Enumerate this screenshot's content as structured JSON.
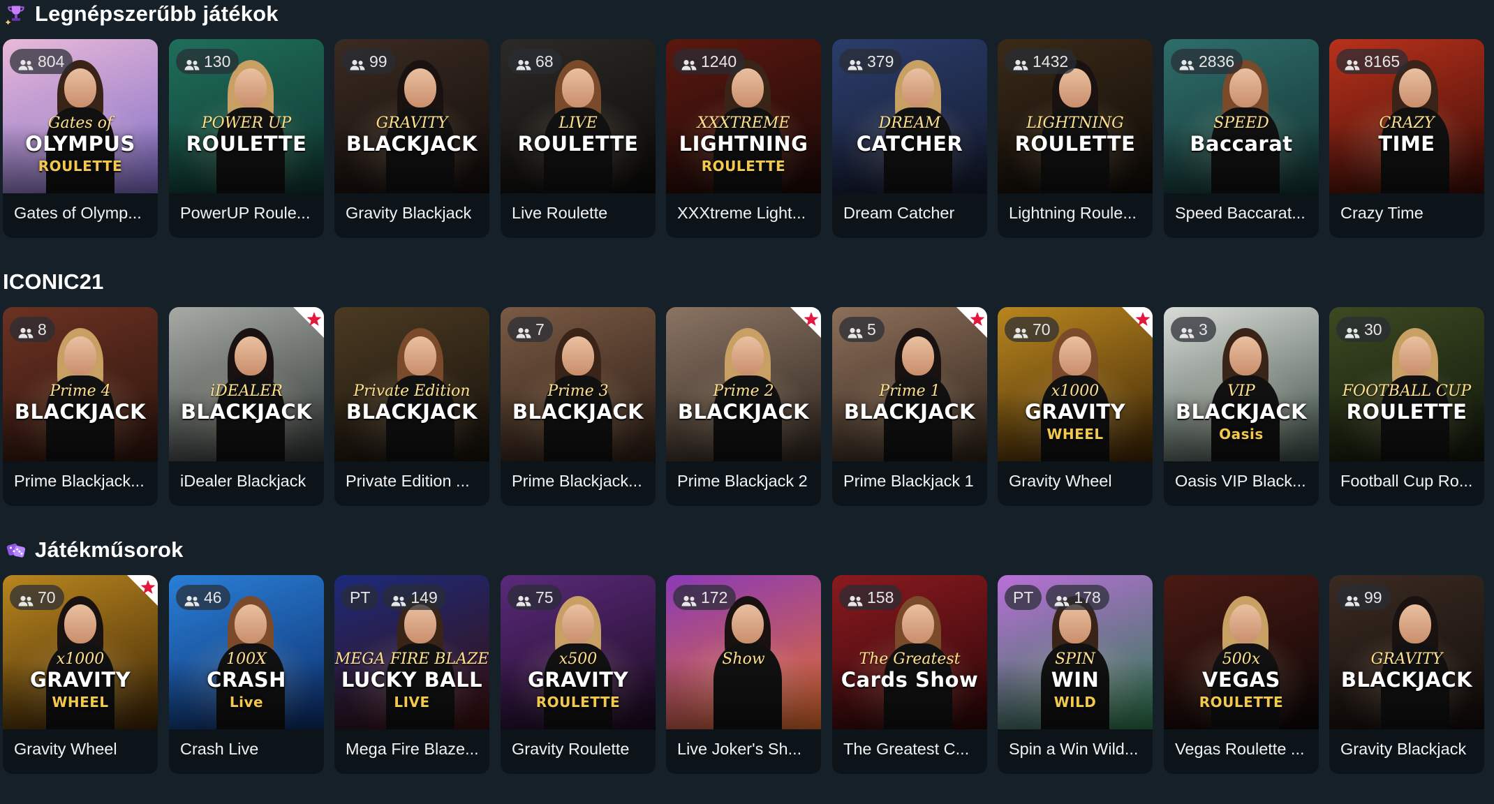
{
  "sections": [
    {
      "title": "Legnépszerűbb játékok",
      "icon": "trophy-sparkle-icon",
      "cards": [
        {
          "title": "Gates of Olymp...",
          "players": "804",
          "pt": "",
          "fav": false,
          "logo": "Gates of",
          "logo2": "OLYMPUS",
          "logo3": "ROULETTE",
          "bg": "#e9b9d8",
          "bg2": "#7d6cc7"
        },
        {
          "title": "PowerUP Roule...",
          "players": "130",
          "pt": "",
          "fav": false,
          "logo": "POWER UP",
          "logo2": "ROULETTE",
          "logo3": "",
          "bg": "#1f6e5a",
          "bg2": "#0f3530"
        },
        {
          "title": "Gravity Blackjack",
          "players": "99",
          "pt": "",
          "fav": false,
          "logo": "GRAVITY",
          "logo2": "BLACKJACK",
          "logo3": "",
          "bg": "#3a2b22",
          "bg2": "#120c0a"
        },
        {
          "title": "Live Roulette",
          "players": "68",
          "pt": "",
          "fav": false,
          "logo": "LIVE",
          "logo2": "ROULETTE",
          "logo3": "",
          "bg": "#2c2a26",
          "bg2": "#0b0a09"
        },
        {
          "title": "XXXtreme Light...",
          "players": "1240",
          "pt": "",
          "fav": false,
          "logo": "XXXTREME",
          "logo2": "LIGHTNING",
          "logo3": "ROULETTE",
          "bg": "#5a1810",
          "bg2": "#1a0806"
        },
        {
          "title": "Dream Catcher",
          "players": "379",
          "pt": "",
          "fav": false,
          "logo": "DREAM",
          "logo2": "CATCHER",
          "logo3": "",
          "bg": "#2b3d6b",
          "bg2": "#141a2e"
        },
        {
          "title": "Lightning Roule...",
          "players": "1432",
          "pt": "",
          "fav": false,
          "logo": "LIGHTNING",
          "logo2": "ROULETTE",
          "logo3": "",
          "bg": "#3a2a18",
          "bg2": "#0e0a06"
        },
        {
          "title": "Speed Baccarat...",
          "players": "2836",
          "pt": "",
          "fav": false,
          "logo": "SPEED",
          "logo2": "Baccarat",
          "logo3": "",
          "bg": "#2f6d6a",
          "bg2": "#123332"
        },
        {
          "title": "Crazy Time",
          "players": "8165",
          "pt": "",
          "fav": false,
          "logo": "CRAZY",
          "logo2": "TIME",
          "logo3": "",
          "bg": "#b8311c",
          "bg2": "#3b0c06"
        }
      ]
    },
    {
      "title": "ICONIC21",
      "icon": "",
      "cards": [
        {
          "title": "Prime Blackjack...",
          "players": "8",
          "pt": "",
          "fav": false,
          "logo": "Prime 4",
          "logo2": "BLACKJACK",
          "logo3": "",
          "bg": "#6b3222",
          "bg2": "#2a130c"
        },
        {
          "title": "iDealer Blackjack",
          "players": "",
          "pt": "",
          "fav": true,
          "logo": "iDEALER",
          "logo2": "BLACKJACK",
          "logo3": "",
          "bg": "#a7aaa5",
          "bg2": "#2e3533"
        },
        {
          "title": "Private Edition ...",
          "players": "",
          "pt": "",
          "fav": false,
          "logo": "Private Edition",
          "logo2": "BLACKJACK",
          "logo3": "",
          "bg": "#4b3a22",
          "bg2": "#15100a"
        },
        {
          "title": "Prime Blackjack...",
          "players": "7",
          "pt": "",
          "fav": false,
          "logo": "Prime 3",
          "logo2": "BLACKJACK",
          "logo3": "",
          "bg": "#7a5a44",
          "bg2": "#2a1c14"
        },
        {
          "title": "Prime Blackjack 2",
          "players": "",
          "pt": "",
          "fav": true,
          "logo": "Prime 2",
          "logo2": "BLACKJACK",
          "logo3": "",
          "bg": "#8a7463",
          "bg2": "#2d241e"
        },
        {
          "title": "Prime Blackjack 1",
          "players": "5",
          "pt": "",
          "fav": true,
          "logo": "Prime 1",
          "logo2": "BLACKJACK",
          "logo3": "",
          "bg": "#8d6f5a",
          "bg2": "#2d2219"
        },
        {
          "title": "Gravity Wheel",
          "players": "70",
          "pt": "",
          "fav": true,
          "logo": "x1000",
          "logo2": "GRAVITY",
          "logo3": "WHEEL",
          "bg": "#b8861f",
          "bg2": "#3d2506"
        },
        {
          "title": "Oasis VIP Black...",
          "players": "3",
          "pt": "",
          "fav": false,
          "logo": "VIP",
          "logo2": "BLACKJACK",
          "logo3": "Oasis",
          "bg": "#d9dcd6",
          "bg2": "#3a4b44"
        },
        {
          "title": "Football Cup Ro...",
          "players": "30",
          "pt": "",
          "fav": false,
          "logo": "FOOTBALL CUP",
          "logo2": "ROULETTE",
          "logo3": "",
          "bg": "#3c4a22",
          "bg2": "#10150a"
        }
      ]
    },
    {
      "title": "Játékműsorok",
      "icon": "dice-icon",
      "cards": [
        {
          "title": "Gravity Wheel",
          "players": "70",
          "pt": "",
          "fav": true,
          "logo": "x1000",
          "logo2": "GRAVITY",
          "logo3": "WHEEL",
          "bg": "#b8861f",
          "bg2": "#3d2506"
        },
        {
          "title": "Crash Live",
          "players": "46",
          "pt": "",
          "fav": false,
          "logo": "100X",
          "logo2": "CRASH",
          "logo3": "Live",
          "bg": "#2a7fd6",
          "bg2": "#0c2d6b"
        },
        {
          "title": "Mega Fire Blaze...",
          "players": "149",
          "pt": "PT",
          "fav": false,
          "logo": "MEGA FIRE BLAZE",
          "logo2": "LUCKY BALL",
          "logo3": "LIVE",
          "bg": "#1c2a7a",
          "bg2": "#3a0f0a"
        },
        {
          "title": "Gravity Roulette",
          "players": "75",
          "pt": "",
          "fav": false,
          "logo": "x500",
          "logo2": "GRAVITY",
          "logo3": "ROULETTE",
          "bg": "#5a2a7a",
          "bg2": "#1a0a1f"
        },
        {
          "title": "Live Joker's Sh...",
          "players": "172",
          "pt": "",
          "fav": false,
          "logo": "Show",
          "logo2": "",
          "logo3": "",
          "bg": "#8a3ab8",
          "bg2": "#e46e2a"
        },
        {
          "title": "The Greatest C...",
          "players": "158",
          "pt": "",
          "fav": false,
          "logo": "The Greatest",
          "logo2": "Cards Show",
          "logo3": "",
          "bg": "#8a1a1f",
          "bg2": "#2a0608"
        },
        {
          "title": "Spin a Win Wild...",
          "players": "178",
          "pt": "PT",
          "fav": false,
          "logo": "SPIN",
          "logo2": "WIN",
          "logo3": "WILD",
          "bg": "#b96fd8",
          "bg2": "#2a7a4a"
        },
        {
          "title": "Vegas Roulette ...",
          "players": "",
          "pt": "",
          "fav": false,
          "logo": "500x",
          "logo2": "VEGAS",
          "logo3": "ROULETTE",
          "bg": "#4a1a14",
          "bg2": "#0c0606"
        },
        {
          "title": "Gravity Blackjack",
          "players": "99",
          "pt": "",
          "fav": false,
          "logo": "GRAVITY",
          "logo2": "BLACKJACK",
          "logo3": "",
          "bg": "#3a2b22",
          "bg2": "#120c0a"
        }
      ]
    }
  ]
}
